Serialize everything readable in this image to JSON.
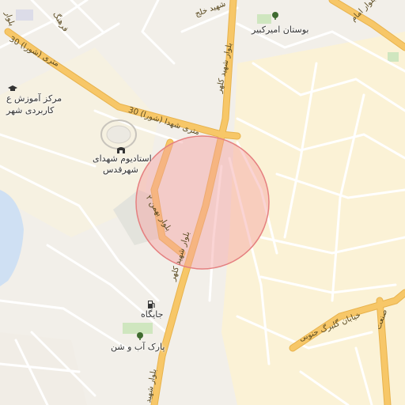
{
  "map": {
    "pois": {
      "park_amirkabir": "بوستان امیرکبیر",
      "training_center_line1": "مرکز آموزش ع",
      "training_center_line2": "کاربردی شهر",
      "stadium_line1": "استادیوم شهدای",
      "stadium_line2": "شهرقدس",
      "gas_station": "جایگاه",
      "park_ab_shen": "پارک آب و شن"
    },
    "roads": {
      "road_30m_west": "30 متری (شورا)",
      "road_30m_east": "30 متری شهدا (شورا)",
      "blvd_kalhor_north": "بلوار شهید کلهر",
      "blvd_kalhor_mid": "بلوار شهید کلهر",
      "blvd_kalhor_south": "بلوار شهید",
      "blvd_bahmani": "بلوار بهمن ۲",
      "khiaban_gonbad": "خیابان گلبرگ جنوبی",
      "road_top_left": "فرهنگ",
      "road_top_mid": "شهید خلج",
      "road_top_right": "بلوار امام",
      "road_top_left2": "بلوار",
      "road_bottom_right": "صنعت"
    },
    "icons": {
      "park": "tree-icon",
      "school": "graduation-cap-icon",
      "stadium": "stadium-icon",
      "fuel": "fuel-pump-icon",
      "park2": "tree-icon"
    },
    "colors": {
      "background": "#f2efe9",
      "residential": "#fbf2d6",
      "major_road": "#f7c768",
      "minor_road": "#ffffff",
      "water": "#cfe0f3",
      "park": "#cfe6bf",
      "search_circle_fill": "#f4a0a0",
      "search_circle_stroke": "#e58080"
    }
  }
}
